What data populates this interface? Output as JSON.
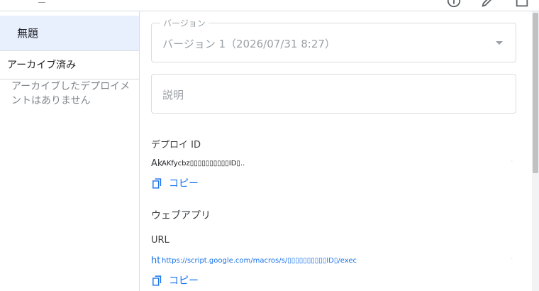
{
  "sidebar": {
    "active_item": "無題",
    "archived_heading": "アーカイブ済み",
    "archived_empty": "アーカイブしたデプロイメントはありません"
  },
  "form": {
    "version_label": "バージョン",
    "version_value": "バージョン 1（2026/07/31 8:27）",
    "description_placeholder": "説明"
  },
  "deployment": {
    "id_label": "デプロイ ID",
    "id_prefix": "Ak",
    "id_value": "AKfycbz▯▯▯▯▯▯▯▯▯▯ID▯..",
    "copy_label": "コピー"
  },
  "webapp": {
    "section_title": "ウェブアプリ",
    "url_label": "URL",
    "url_prefix": "ht",
    "url_value": "https://script.google.com/macros/s/▯▯▯▯▯▯▯▯▯▯ID▯/exec",
    "copy_label": "コピー"
  },
  "colors": {
    "accent": "#1a73e8",
    "active_bg": "#e8f0fe",
    "border": "#dadce0"
  },
  "icons": {
    "top_right": [
      "help-icon",
      "edit-icon",
      "open-in-new-icon"
    ],
    "copy": "copy-icon",
    "dropdown": "arrow-drop-down-icon"
  }
}
